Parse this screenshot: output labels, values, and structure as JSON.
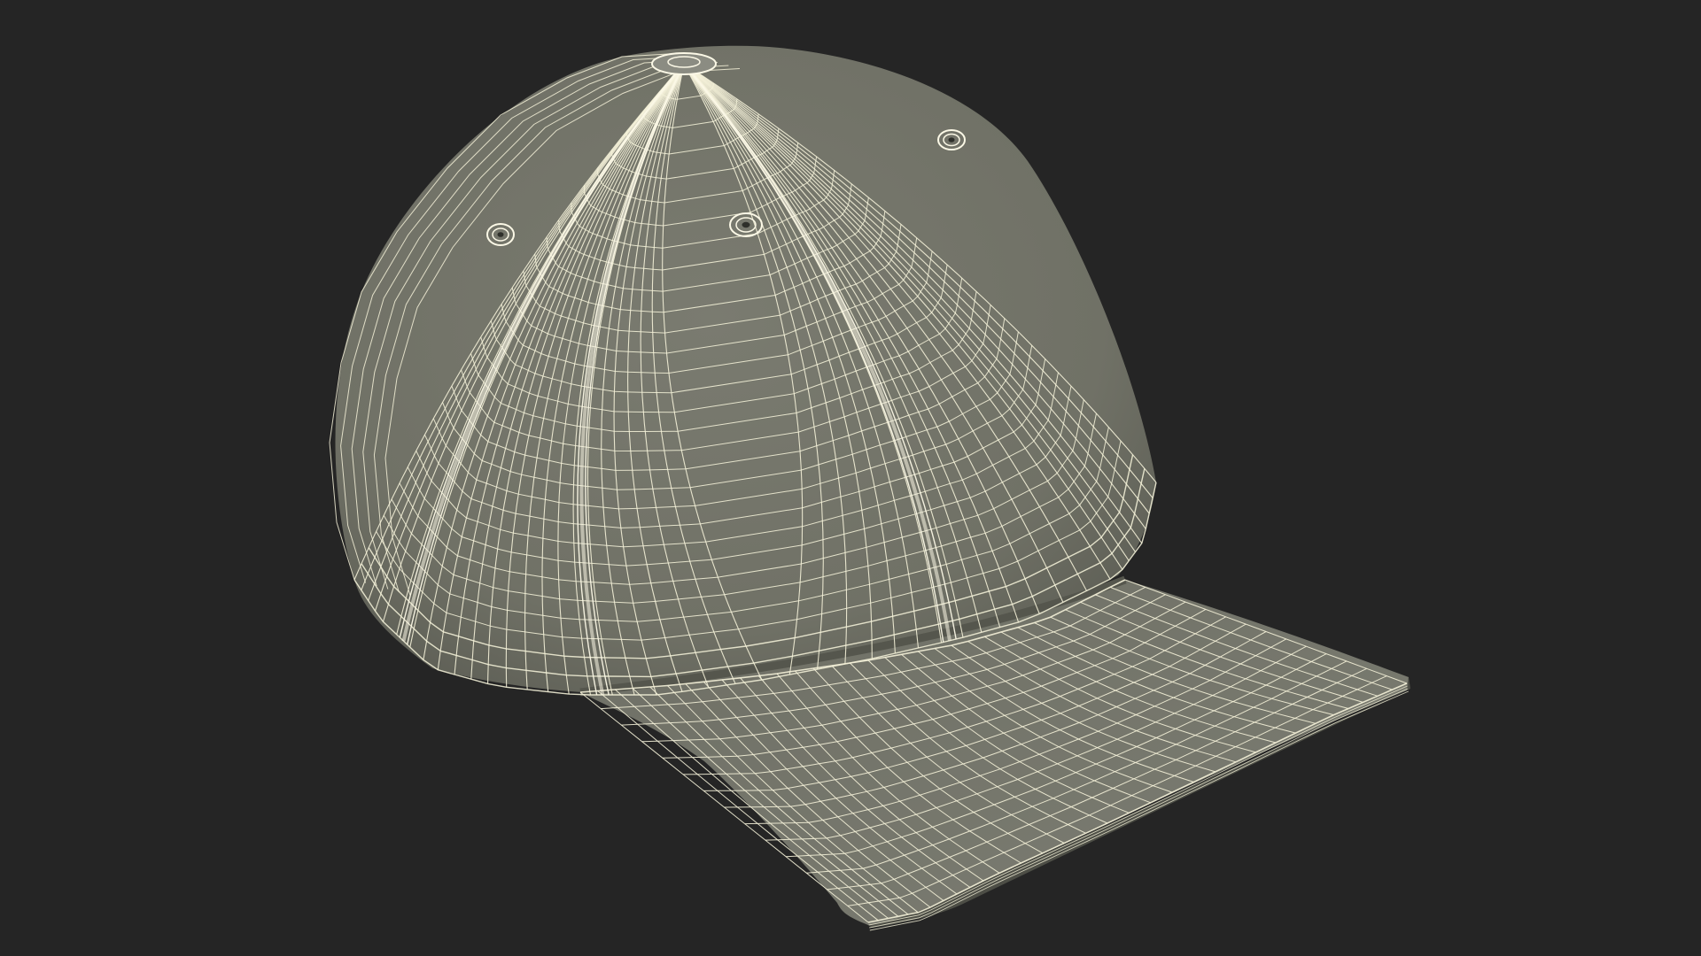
{
  "scene": {
    "subject": "baseball-cap",
    "render_style": "wireframe",
    "colors": {
      "background": "#252525",
      "surface": "#76776c",
      "surface_shadow": "#5f6057",
      "surface_light": "#8a8b80",
      "wire": "#f4f1d8",
      "seam": "#fbf8e6",
      "rim_shadow": "#45463f"
    }
  }
}
